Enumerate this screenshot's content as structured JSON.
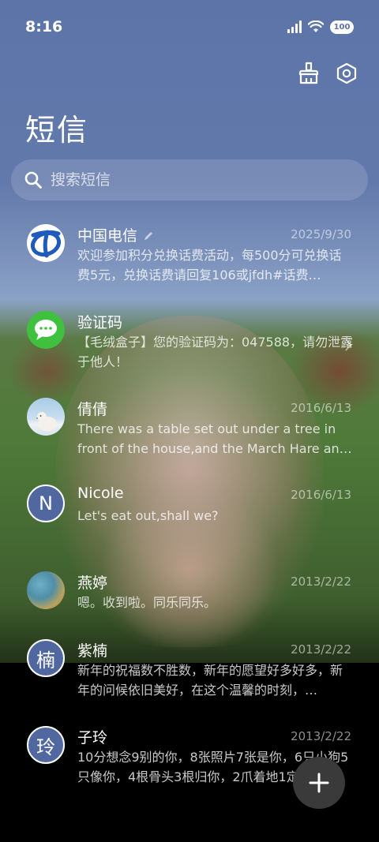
{
  "status_bar": {
    "time": "8:16",
    "battery": "100"
  },
  "toolbar": {
    "clean_icon": "broom-icon",
    "settings_icon": "settings-hexagon-icon"
  },
  "header": {
    "title": "短信"
  },
  "search": {
    "placeholder": "搜索短信"
  },
  "conversations": [
    {
      "name": "中国电信",
      "date": "2025/9/30",
      "preview": "欢迎参加积分兑换话费活动，每500分可兑换话费5元，兑换话费请回复106或jfdh#话费…",
      "avatar": "china-telecom-logo",
      "has_edit_mark": true
    },
    {
      "name": "验证码",
      "date": "",
      "preview": "【毛绒盒子】您的验证码为：047588，请勿泄露于他人！",
      "avatar": "message-bubble-icon",
      "has_chevron": true
    },
    {
      "name": "倩倩",
      "date": "2016/6/13",
      "preview": "There was a table set out under a tree in front of the house,and the March Hare an…",
      "avatar": "polar-bear-photo"
    },
    {
      "name": "Nicole",
      "date": "2016/6/13",
      "preview": "Let's eat out,shall we?",
      "avatar_letter": "N"
    },
    {
      "name": "燕婷",
      "date": "2013/2/22",
      "preview": "嗯。收到啦。同乐同乐。",
      "avatar": "landscape-photo"
    },
    {
      "name": "紫楠",
      "date": "2013/2/22",
      "preview": "新年的祝福数不胜数，新年的愿望好多好多，新年的问候依旧美好，在这个温馨的时刻，…",
      "avatar_letter": "楠"
    },
    {
      "name": "子玲",
      "date": "2013/2/22",
      "preview": "10分想念9别的你，8张照片7张是你，6只小狗5只像你，4根骨头3根归你，2爪着地1定…",
      "avatar_letter": "玲"
    }
  ],
  "fab": {
    "icon": "plus-icon"
  },
  "colors": {
    "letter_avatar_bg": "#50689f",
    "telecom_blue": "#1e5bbd",
    "message_green": "#3fc13f",
    "fab_bg": "#3a3a3a"
  }
}
